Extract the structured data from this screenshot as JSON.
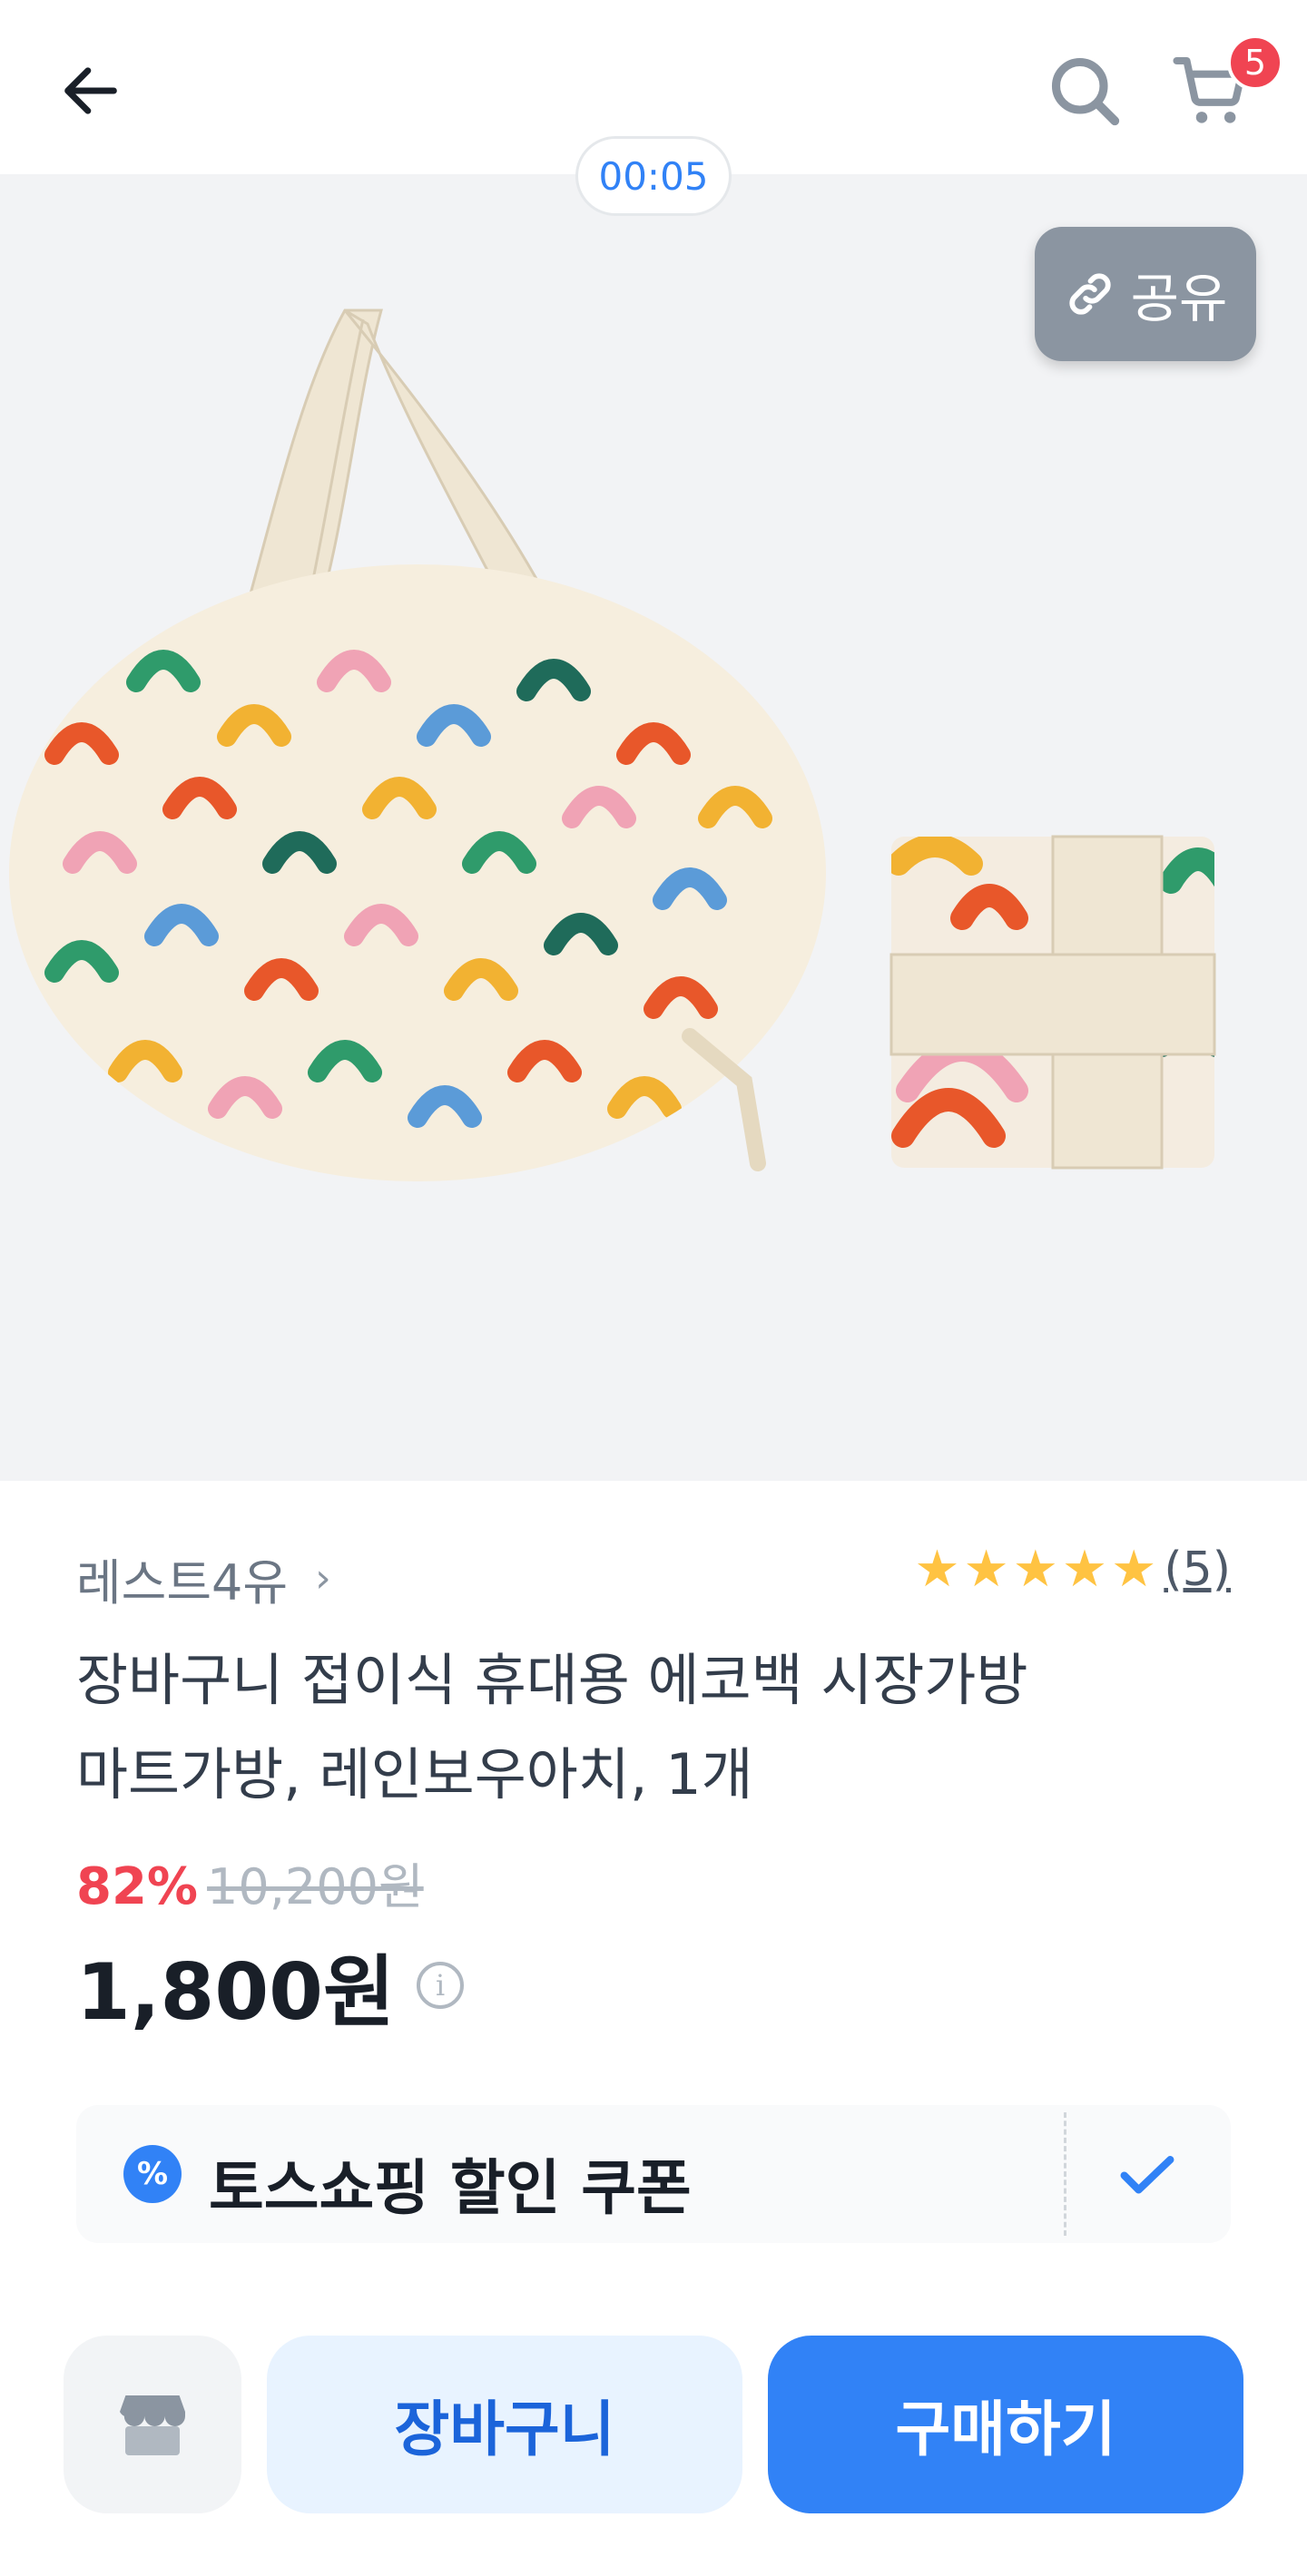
{
  "header": {
    "cart_count": "5"
  },
  "hero": {
    "timer": "00:05",
    "share_label": "공유",
    "image_alt": "product-image"
  },
  "store": {
    "name": "레스트4유",
    "rating": 5,
    "review_count": "(5)"
  },
  "product": {
    "title_line1": "장바구니 접이식 휴대용 에코백 시장가방",
    "title_line2": "마트가방, 레인보우아치, 1개",
    "discount_rate": "82%",
    "original_price": "10,200원",
    "price": "1,800원"
  },
  "coupon": {
    "icon": "%",
    "label": "토스쇼핑 할인 쿠폰"
  },
  "bottom": {
    "cart_label": "장바구니",
    "buy_label": "구매하기"
  },
  "colors": {
    "accent": "#3182f6",
    "badge": "#f04452",
    "star": "#ffc342"
  }
}
